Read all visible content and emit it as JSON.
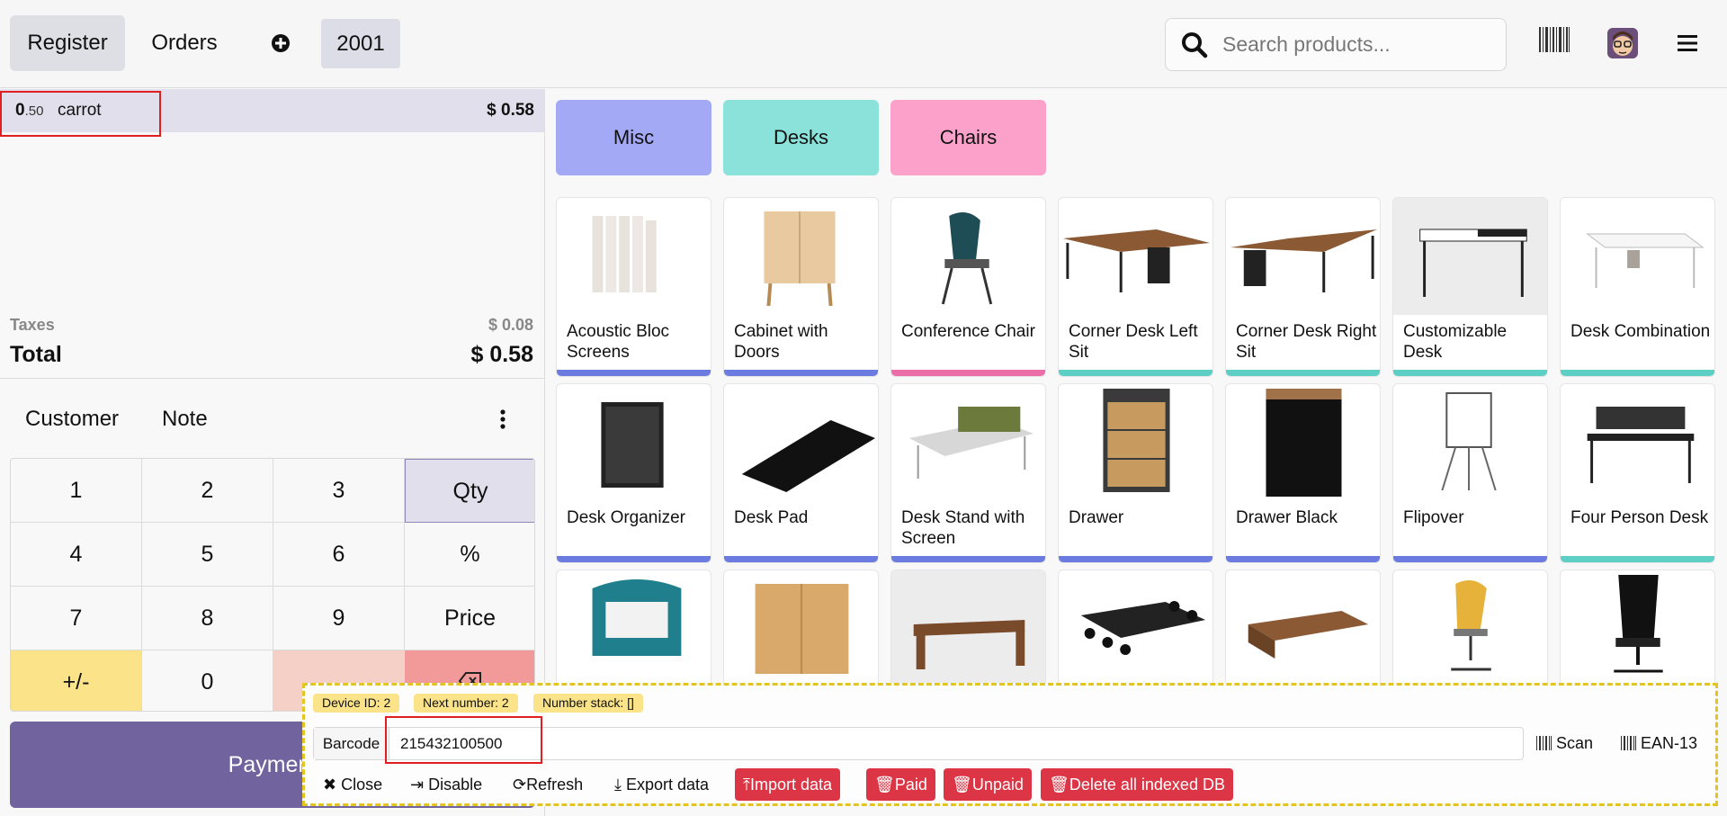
{
  "header": {
    "register_label": "Register",
    "orders_label": "Orders",
    "order_number": "2001",
    "search_placeholder": "Search products..."
  },
  "order": {
    "lines": [
      {
        "qty_int": "0",
        "qty_dec": ".50",
        "product": "carrot",
        "price": "$ 0.58"
      }
    ],
    "taxes_label": "Taxes",
    "taxes_value": "$ 0.08",
    "total_label": "Total",
    "total_value": "$ 0.58"
  },
  "controls": {
    "customer_label": "Customer",
    "note_label": "Note"
  },
  "numpad": {
    "keys": [
      "1",
      "2",
      "3",
      "Qty",
      "4",
      "5",
      "6",
      "%",
      "7",
      "8",
      "9",
      "Price",
      "+/-",
      "0",
      "",
      ""
    ]
  },
  "payment_label": "Payment",
  "categories": [
    {
      "label": "Misc",
      "color": "#a4a9f5"
    },
    {
      "label": "Desks",
      "color": "#8be2da"
    },
    {
      "label": "Chairs",
      "color": "#fca2ca"
    }
  ],
  "products": [
    {
      "name": "Acoustic Bloc Screens",
      "bar": "#6c7be0"
    },
    {
      "name": "Cabinet with Doors",
      "bar": "#6c7be0"
    },
    {
      "name": "Conference Chair",
      "bar": "#ec6ea8"
    },
    {
      "name": "Corner Desk Left Sit",
      "bar": "#5dcfc5"
    },
    {
      "name": "Corner Desk Right Sit",
      "bar": "#5dcfc5"
    },
    {
      "name": "Customizable Desk",
      "bar": "#5dcfc5"
    },
    {
      "name": "Desk Combination",
      "bar": "#5dcfc5"
    },
    {
      "name": "Desk Organizer",
      "bar": "#6c7be0"
    },
    {
      "name": "Desk Pad",
      "bar": "#6c7be0"
    },
    {
      "name": "Desk Stand with Screen",
      "bar": "#6c7be0"
    },
    {
      "name": "Drawer",
      "bar": "#6c7be0"
    },
    {
      "name": "Drawer Black",
      "bar": "#6c7be0"
    },
    {
      "name": "Flipover",
      "bar": "#6c7be0"
    },
    {
      "name": "Four Person Desk",
      "bar": "#5dcfc5"
    },
    {
      "name": "",
      "bar": ""
    },
    {
      "name": "",
      "bar": ""
    },
    {
      "name": "",
      "bar": ""
    },
    {
      "name": "",
      "bar": ""
    },
    {
      "name": "",
      "bar": ""
    },
    {
      "name": "",
      "bar": ""
    },
    {
      "name": "",
      "bar": ""
    }
  ],
  "debug": {
    "device_id": "Device ID: 2",
    "next_number": "Next number: 2",
    "number_stack": "Number stack: []",
    "barcode_label": "Barcode",
    "barcode_value": "215432100500",
    "scan_label": "Scan",
    "format_label": "EAN-13",
    "buttons": {
      "close": "Close",
      "disable": "Disable",
      "refresh": "Refresh",
      "export": "Export data",
      "import": "Import data",
      "paid": "Paid",
      "unpaid": "Unpaid",
      "delete_db": "Delete all indexed DB"
    }
  }
}
